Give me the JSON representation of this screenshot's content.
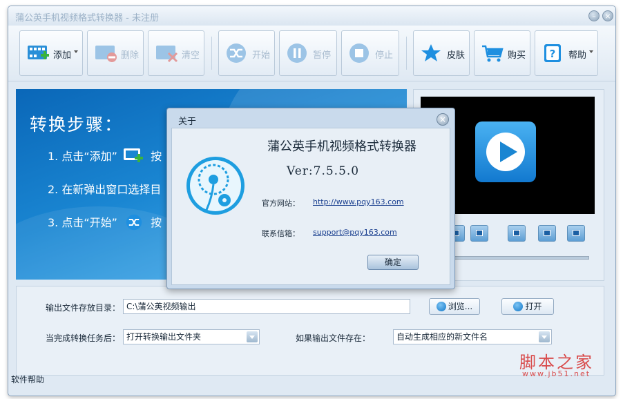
{
  "window": {
    "title": "蒲公英手机视频格式转换器 - 未注册"
  },
  "toolbar": {
    "add": "添加",
    "delete": "删除",
    "clear": "清空",
    "start": "开始",
    "pause": "暂停",
    "stop": "停止",
    "skin": "皮肤",
    "buy": "购买",
    "help": "帮助"
  },
  "banner": {
    "title": "转换步骤：",
    "step1": "1. 点击“添加”",
    "step1_tail": "按",
    "step2": "2. 在新弹出窗口选择目",
    "step3": "3. 点击“开始”",
    "step3_tail": "按"
  },
  "settings": {
    "output_dir_label": "输出文件存放目录：",
    "output_dir_value": "C:\\蒲公英视频输出",
    "browse": "浏览...",
    "open": "打开",
    "on_complete_label": "当完成转换任务后：",
    "on_complete_value": "打开转换输出文件夹",
    "if_exists_label": "如果输出文件存在：",
    "if_exists_value": "自动生成相应的新文件名"
  },
  "status": {
    "help": "软件帮助"
  },
  "watermark": {
    "text": "脚本之家",
    "url": "www.jb51.net"
  },
  "dialog": {
    "title": "关于",
    "app_name": "蒲公英手机视频格式转换器",
    "version": "Ver:7.5.5.0",
    "website_label": "官方网站：",
    "website": "http://www.pqy163.com",
    "email_label": "联系信箱：",
    "email": "support@pqy163.com",
    "ok": "确定"
  },
  "colors": {
    "accent": "#1a86d2",
    "dialog_bg": "#c9daec",
    "watermark": "#d94c4c"
  }
}
